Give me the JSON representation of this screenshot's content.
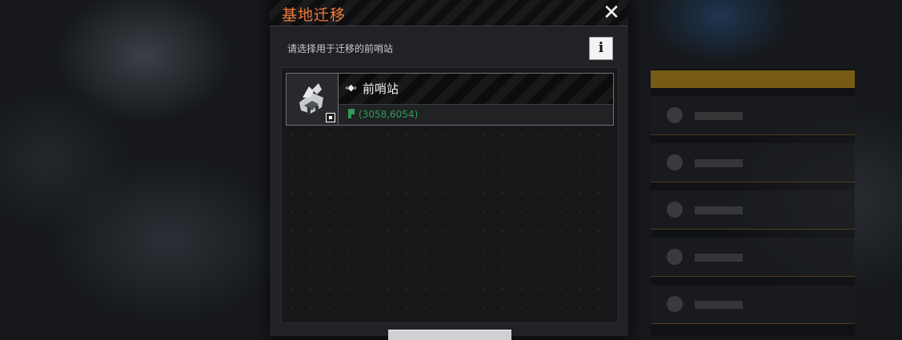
{
  "dialog": {
    "title": "基地迁移",
    "close_icon": "close-icon",
    "subtitle": "请选择用于迁移的前哨站",
    "info_label": "i",
    "accent_color": "#f07a3a"
  },
  "outposts": [
    {
      "diamond_glyph": "◆",
      "name": "前哨站",
      "coords": "(3058,6054)",
      "coord_color": "#2e9b56"
    }
  ],
  "confirm_button": {
    "label": ""
  }
}
